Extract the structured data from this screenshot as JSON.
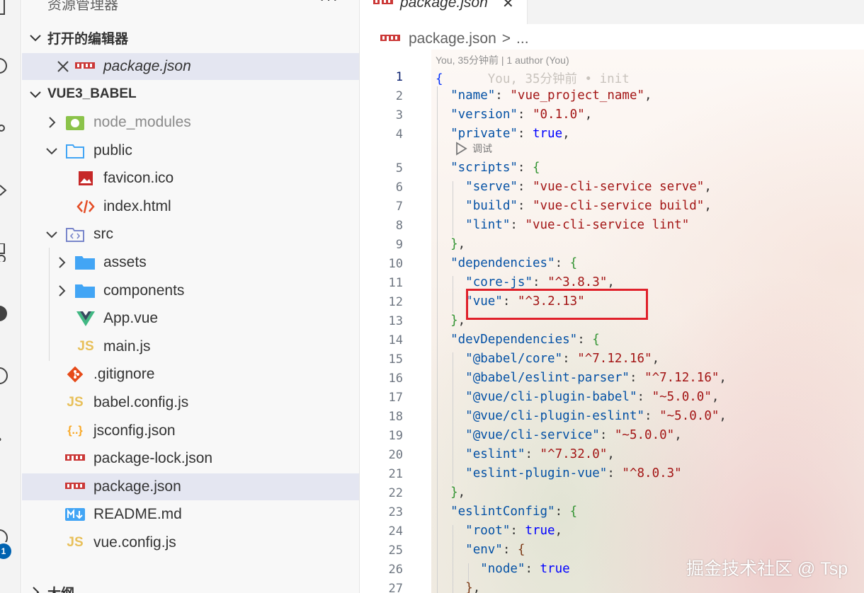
{
  "sidebar": {
    "header": "资源管理器",
    "more": "···",
    "sections": {
      "open_editors": "打开的编辑器",
      "project": "VUE3_BABEL",
      "outline": "大纲"
    },
    "open_editors": [
      {
        "label": "package.json",
        "icon": "npm-icon"
      }
    ],
    "tree": [
      {
        "label": "node_modules",
        "icon": "nodejs-folder-icon",
        "type": "folder",
        "expanded": false
      },
      {
        "label": "public",
        "icon": "folder-icon",
        "type": "folder",
        "expanded": true
      },
      {
        "label": "favicon.ico",
        "icon": "image-icon",
        "type": "file"
      },
      {
        "label": "index.html",
        "icon": "html-icon",
        "type": "file"
      },
      {
        "label": "src",
        "icon": "src-folder-icon",
        "type": "folder",
        "expanded": true
      },
      {
        "label": "assets",
        "icon": "folder-icon",
        "type": "folder",
        "expanded": false
      },
      {
        "label": "components",
        "icon": "folder-icon",
        "type": "folder",
        "expanded": false
      },
      {
        "label": "App.vue",
        "icon": "vue-icon",
        "type": "file"
      },
      {
        "label": "main.js",
        "icon": "js-icon",
        "type": "file"
      },
      {
        "label": ".gitignore",
        "icon": "git-icon",
        "type": "file"
      },
      {
        "label": "babel.config.js",
        "icon": "js-icon",
        "type": "file"
      },
      {
        "label": "jsconfig.json",
        "icon": "json-icon",
        "type": "file"
      },
      {
        "label": "package-lock.json",
        "icon": "npm-icon",
        "type": "file"
      },
      {
        "label": "package.json",
        "icon": "npm-icon",
        "type": "file",
        "selected": true
      },
      {
        "label": "README.md",
        "icon": "markdown-icon",
        "type": "file"
      },
      {
        "label": "vue.config.js",
        "icon": "js-icon",
        "type": "file"
      }
    ],
    "activity_badge": "1"
  },
  "editor": {
    "tab_label": "package.json",
    "tab_close": "✕",
    "breadcrumb": {
      "file": "package.json",
      "sep": ">",
      "rest": "..."
    },
    "codelens": "You, 35分钟前 | 1 author (You)",
    "debug_label": "调试",
    "blame_inline": "You, 35分钟前 • init",
    "lines": [
      {
        "n": "1",
        "key": "",
        "value": "",
        "text": "{"
      },
      {
        "n": "2",
        "key": "\"name\"",
        "value": "\"vue_project_name\""
      },
      {
        "n": "3",
        "key": "\"version\"",
        "value": "\"0.1.0\""
      },
      {
        "n": "4",
        "key": "\"private\"",
        "value": "true"
      },
      {
        "n": "5",
        "key": "\"scripts\"",
        "value": "{"
      },
      {
        "n": "6",
        "key": "\"serve\"",
        "value": "\"vue-cli-service serve\""
      },
      {
        "n": "7",
        "key": "\"build\"",
        "value": "\"vue-cli-service build\""
      },
      {
        "n": "8",
        "key": "\"lint\"",
        "value": "\"vue-cli-service lint\""
      },
      {
        "n": "9",
        "text": "},"
      },
      {
        "n": "10",
        "key": "\"dependencies\"",
        "value": "{"
      },
      {
        "n": "11",
        "key": "\"core-js\"",
        "value": "\"^3.8.3\""
      },
      {
        "n": "12",
        "key": "\"vue\"",
        "value": "\"^3.2.13\""
      },
      {
        "n": "13",
        "text": "},"
      },
      {
        "n": "14",
        "key": "\"devDependencies\"",
        "value": "{"
      },
      {
        "n": "15",
        "key": "\"@babel/core\"",
        "value": "\"^7.12.16\""
      },
      {
        "n": "16",
        "key": "\"@babel/eslint-parser\"",
        "value": "\"^7.12.16\""
      },
      {
        "n": "17",
        "key": "\"@vue/cli-plugin-babel\"",
        "value": "\"~5.0.0\""
      },
      {
        "n": "18",
        "key": "\"@vue/cli-plugin-eslint\"",
        "value": "\"~5.0.0\""
      },
      {
        "n": "19",
        "key": "\"@vue/cli-service\"",
        "value": "\"~5.0.0\""
      },
      {
        "n": "20",
        "key": "\"eslint\"",
        "value": "\"^7.32.0\""
      },
      {
        "n": "21",
        "key": "\"eslint-plugin-vue\"",
        "value": "\"^8.0.3\""
      },
      {
        "n": "22",
        "text": "},"
      },
      {
        "n": "23",
        "key": "\"eslintConfig\"",
        "value": "{"
      },
      {
        "n": "24",
        "key": "\"root\"",
        "value": "true"
      },
      {
        "n": "25",
        "key": "\"env\"",
        "value": "{"
      },
      {
        "n": "26",
        "key": "\"node\"",
        "value": "true"
      },
      {
        "n": "27",
        "text": "},"
      }
    ]
  },
  "watermark": "掘金技术社区 @ Tsp",
  "colors": {
    "key": "#0451a5",
    "string": "#a31515",
    "boolean": "#0000ff",
    "highlight_box": "#e0202a",
    "selection": "#e4e6f1"
  }
}
